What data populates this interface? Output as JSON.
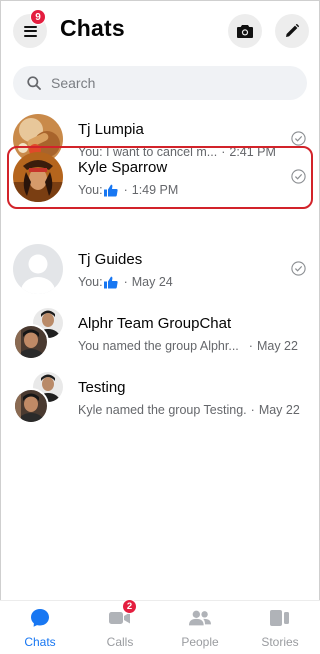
{
  "header": {
    "title": "Chats",
    "menu_badge": "9",
    "menu_icon": "hamburger-menu-icon",
    "camera_icon": "camera-icon",
    "compose_icon": "pencil-icon"
  },
  "search": {
    "placeholder": "Search",
    "icon": "search-icon"
  },
  "chats": [
    {
      "name": "Tj Lumpia",
      "preview": "You: I want to cancel m...",
      "time": "2:41 PM",
      "status": "seen-check"
    },
    {
      "name": "Kyle Sparrow",
      "prefix": "You:",
      "preview_icon": "thumbs-up",
      "time": "1:49 PM",
      "status": "seen-check",
      "highlighted": true
    },
    {
      "name": "Tj Guides",
      "prefix": "You:",
      "preview_icon": "thumbs-up",
      "time": "May 24",
      "status": "seen-check"
    },
    {
      "name": "Alphr Team GroupChat",
      "preview": "You named the group Alphr...",
      "time": "May 22"
    },
    {
      "name": "Testing",
      "preview": "Kyle named the group Testing.",
      "time": "May 22"
    }
  ],
  "nav": {
    "items": [
      {
        "label": "Chats",
        "icon": "chat-bubble-icon",
        "active": true
      },
      {
        "label": "Calls",
        "icon": "video-camera-icon",
        "badge": "2"
      },
      {
        "label": "People",
        "icon": "people-icon"
      },
      {
        "label": "Stories",
        "icon": "stories-icon"
      }
    ]
  },
  "colors": {
    "accent": "#1877f2",
    "badge": "#e41e3f",
    "highlight": "#d2232a",
    "secondary_text": "#65676b"
  }
}
